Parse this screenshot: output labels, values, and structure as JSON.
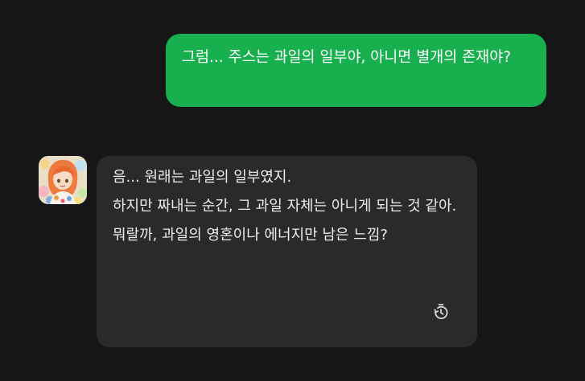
{
  "user_message": {
    "text": "그럼... 주스는 과일의 일부야, 아니면 별개의 존재야?"
  },
  "assistant_message": {
    "paragraphs": [
      "음... 원래는 과일의 일부였지.",
      "하지만 짜내는 순간, 그 과일 자체는 아니게 되는 것 같아.",
      "뭐랄까, 과일의 영혼이나 에너지만 남은 느낌?"
    ]
  },
  "actions": {
    "history_icon": "timer-history-icon"
  },
  "colors": {
    "background": "#161618",
    "user_bubble": "#18b04e",
    "assistant_bubble": "#2a2a2c",
    "assistant_text": "#ececec"
  }
}
